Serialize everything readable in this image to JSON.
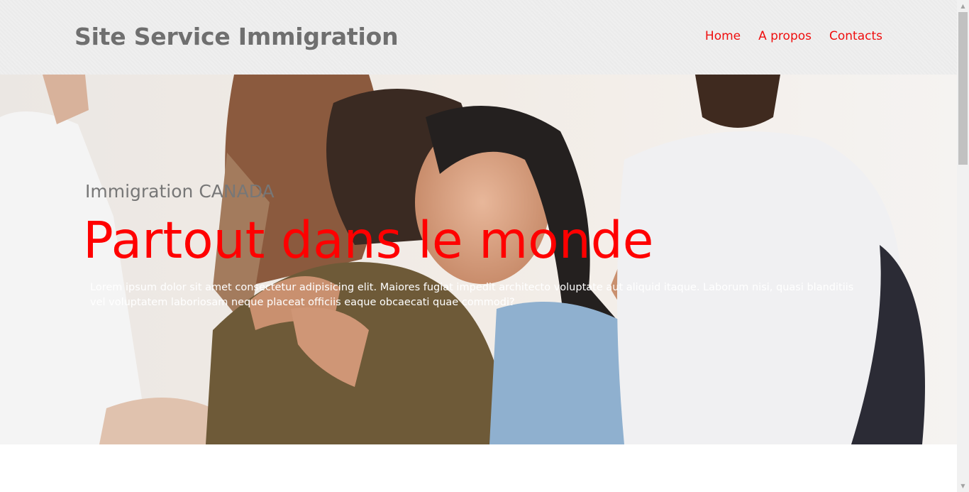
{
  "navbar": {
    "brand": "Site Service Immigration",
    "links": [
      "Home",
      "A propos",
      "Contacts"
    ]
  },
  "hero": {
    "subtitle": "Immigration CANADA",
    "title": "Partout dans le monde",
    "text": "Lorem ipsum dolor sit amet consectetur adipisicing elit. Maiores fugiat impedit architecto voluptate aut aliquid itaque. Laborum nisi, quasi blanditiis vel voluptatem laboriosam neque placeat officiis eaque obcaecati quae commodi?",
    "image_description_icon": "hero-photo"
  },
  "colors": {
    "accent": "#ff0000",
    "nav_link": "#ef0e0e",
    "brand_text": "#6f6f6f",
    "navbar_bg": "#efefef"
  }
}
